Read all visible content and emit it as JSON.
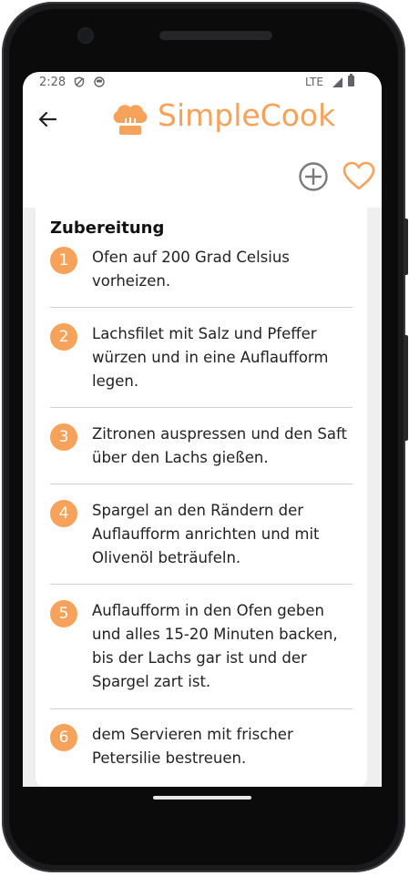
{
  "status_bar": {
    "time": "2:28",
    "network": "LTE"
  },
  "header": {
    "app_name": "SimpleCook"
  },
  "section": {
    "title": "Zubereitung"
  },
  "steps": [
    {
      "number": "1",
      "text": "Ofen auf 200 Grad Celsius vorheizen."
    },
    {
      "number": "2",
      "text": "Lachsfilet mit Salz und Pfeffer würzen und in eine Auflaufform legen."
    },
    {
      "number": "3",
      "text": "Zitronen auspressen und den Saft über den Lachs gießen."
    },
    {
      "number": "4",
      "text": "Spargel an den Rändern der Auflaufform anrichten und mit Olivenöl beträufeln."
    },
    {
      "number": "5",
      "text": "Auflaufform in den Ofen geben und alles 15-20 Minuten backen, bis der Lachs gar ist und der Spargel zart ist."
    },
    {
      "number": "6",
      "text": "dem Servieren mit frischer Petersilie bestreuen."
    }
  ],
  "colors": {
    "accent": "#f6a25a",
    "icon_gray": "#7a7a7a",
    "divider": "#cfcfcf"
  },
  "icons": [
    "back-arrow-icon",
    "chef-hat-icon",
    "add-circle-icon",
    "heart-outline-icon"
  ]
}
